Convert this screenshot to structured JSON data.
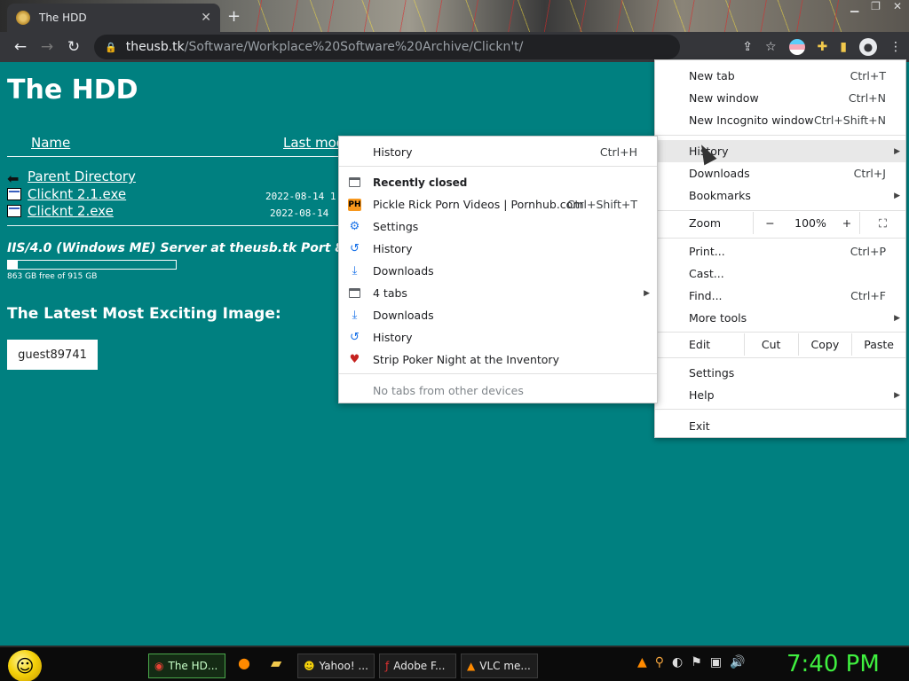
{
  "browser": {
    "tab_title": "The HDD",
    "url_host": "theusb.tk",
    "url_path": "/Software/Workplace%20Software%20Archive/Clickn't/",
    "tab_close": "✕",
    "new_tab": "+"
  },
  "page": {
    "title": "The HDD",
    "col_name": "Name",
    "col_modified": "Last mod",
    "parent": "Parent Directory",
    "files": [
      {
        "name": "Clicknt 2.1.exe",
        "date": "2022-08-14 1"
      },
      {
        "name": "Clicknt 2.exe",
        "date": "2022-08-14"
      }
    ],
    "server": "IIS/4.0 (Windows ME) Server at theusb.tk Port 8",
    "disk_used_fraction": 0.057,
    "disk_free": "863 GB free of 915 GB",
    "latest_heading": "The Latest Most Exciting Image:",
    "guest": "guest89741"
  },
  "main_menu": {
    "items": [
      {
        "label": "New tab",
        "shortcut": "Ctrl+T"
      },
      {
        "label": "New window",
        "shortcut": "Ctrl+N"
      },
      {
        "label": "New Incognito window",
        "shortcut": "Ctrl+Shift+N"
      },
      {
        "label": "History",
        "shortcut": ""
      },
      {
        "label": "Downloads",
        "shortcut": "Ctrl+J"
      },
      {
        "label": "Bookmarks",
        "shortcut": ""
      },
      {
        "label": "Print...",
        "shortcut": "Ctrl+P"
      },
      {
        "label": "Cast...",
        "shortcut": ""
      },
      {
        "label": "Find...",
        "shortcut": "Ctrl+F"
      },
      {
        "label": "More tools",
        "shortcut": ""
      },
      {
        "label": "Settings",
        "shortcut": ""
      },
      {
        "label": "Help",
        "shortcut": ""
      },
      {
        "label": "Exit",
        "shortcut": ""
      }
    ],
    "zoom_label": "Zoom",
    "zoom_minus": "−",
    "zoom_value": "100%",
    "zoom_plus": "+",
    "edit_label": "Edit",
    "cut": "Cut",
    "copy": "Copy",
    "paste": "Paste"
  },
  "history_menu": {
    "history": "History",
    "history_shortcut": "Ctrl+H",
    "recently_closed": "Recently closed",
    "items": [
      {
        "label": "Pickle Rick Porn Videos | Pornhub.com",
        "shortcut": "Ctrl+Shift+T",
        "icon": "ph-icon"
      },
      {
        "label": "Settings",
        "shortcut": "",
        "icon": "gear-icon"
      },
      {
        "label": "History",
        "shortcut": "",
        "icon": "history-icon"
      },
      {
        "label": "Downloads",
        "shortcut": "",
        "icon": "download-icon"
      },
      {
        "label": "4 tabs",
        "shortcut": "",
        "icon": "tabs-icon"
      },
      {
        "label": "Downloads",
        "shortcut": "",
        "icon": "download-icon"
      },
      {
        "label": "History",
        "shortcut": "",
        "icon": "history-icon"
      },
      {
        "label": "Strip Poker Night at the Inventory",
        "shortcut": "",
        "icon": "heart-icon"
      }
    ],
    "no_tabs": "No tabs from other devices",
    "ph_badge": "PH"
  },
  "taskbar": {
    "buttons": [
      "The HD...",
      "Yahoo! ...",
      "Adobe F...",
      "VLC me..."
    ],
    "clock": "7:40 PM"
  },
  "colors": {
    "page_bg": "#008080",
    "clock": "#3ff03f"
  }
}
